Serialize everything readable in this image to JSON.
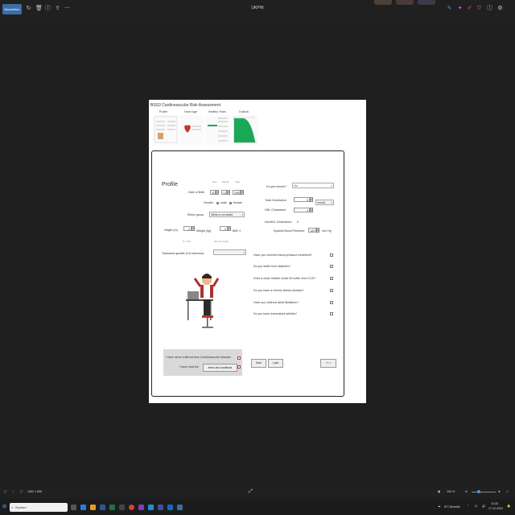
{
  "toolbar": {
    "edit_label": "Bearbeiten",
    "doc_title": "UKPHI"
  },
  "app": {
    "title": "BSS3 Cardiovascular Risk Assessment",
    "steps": [
      "Profile",
      "Heart Age",
      "Healthy Years",
      "Outlook"
    ]
  },
  "form": {
    "heading": "Profile",
    "dob_label": "Date of Birth",
    "day_label": "Day",
    "month_label": "Month",
    "year_label": "Year",
    "day": "31",
    "month": "12",
    "year": "1990",
    "gender_label": "Gender",
    "male_label": "male",
    "female_label": "female",
    "ethnic_label": "Ethnic group",
    "ethnic_value": "White or not stated",
    "height_label": "Height (m)",
    "height_value": "0",
    "height_hint": "0' 0\"(ft')",
    "weight_label": "Weight (kg)",
    "weight_value": "0",
    "weight_hint": "0st 0 lb (st lb)",
    "bmi_label": "BMI: 0",
    "townsend_label": "Townsend quintile (3 if unknown)",
    "smoke_label": "Do you smoke?",
    "smoke_value": "No",
    "cholesterol_label": "Total Cholesterol",
    "cholesterol_value": "0",
    "hdl_label": "HDL Cholesterol",
    "hdl_value": "0",
    "unit_value": "mmol/L",
    "nonhdl_label": "NonHDL Cholesterol:",
    "nonhdl_value": "0",
    "bp_label": "Systolic Blood Pressure:",
    "bp_value": "120",
    "bp_unit": "mm Hg",
    "questions": [
      "Have you received blood pressure treatment?",
      "Do you suffer from diabetes?",
      "Does a close relative under 60 suffer from CVD?",
      "Do you have a chronic kidney disease?",
      "Have you suffered atrial fibrillation?",
      "Do you have rheumatoid arthritis?"
    ],
    "never_cvd_label": "I have never suffered from Cardiovascular Disease",
    "read_label": "I have read the",
    "terms_label": "terms and conditions",
    "save_label": "Save",
    "load_label": "Load",
    "next_label": "Next"
  },
  "status": {
    "dimensions": "1052 x 858",
    "zoom": "100 %"
  },
  "taskbar": {
    "search_placeholder": "Suchen",
    "weather": "8°C Bewölkt",
    "time": "13:33",
    "date": "17.12.2024"
  },
  "colors": {
    "accent": "#3a6ea5",
    "chart_green": "#1aaa55",
    "heart_red": "#c0392b"
  }
}
